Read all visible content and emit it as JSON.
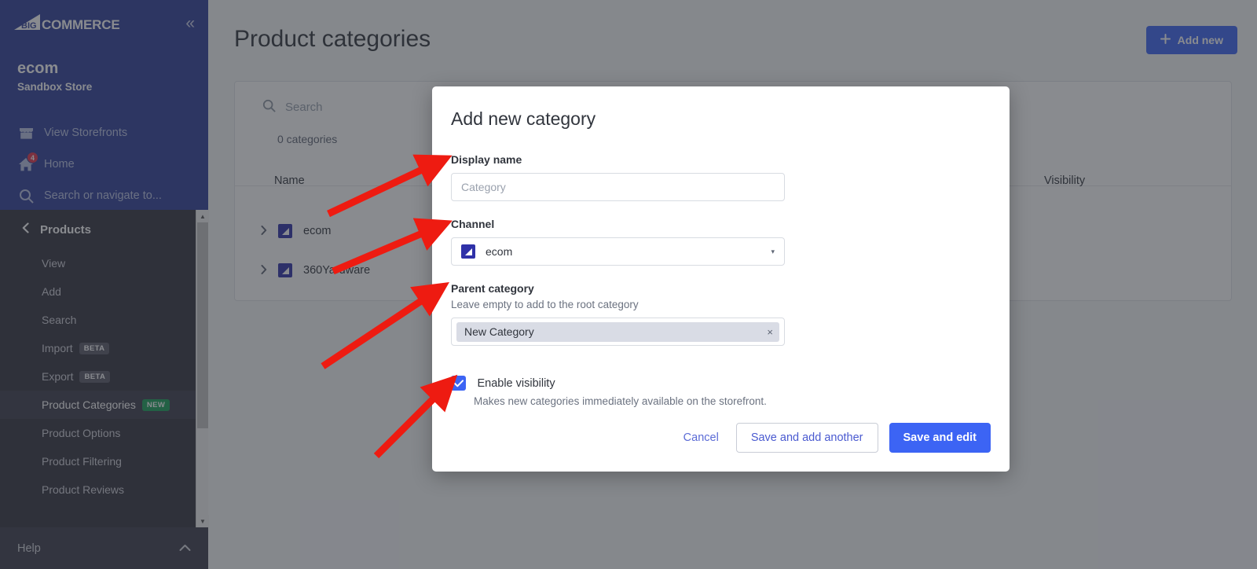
{
  "sidebar": {
    "logo_text": "COMMERCE",
    "logo_mark": "big-triangle-logo",
    "collapse_icon": "«",
    "store_name": "ecom",
    "store_subtitle": "Sandbox Store",
    "links": [
      {
        "label": "View Storefronts",
        "icon": "storefront-icon",
        "badge": null
      },
      {
        "label": "Home",
        "icon": "home-icon",
        "badge": "4"
      },
      {
        "label": "Search or navigate to...",
        "icon": "search-icon",
        "badge": null
      }
    ],
    "nav": {
      "back_label": "Products",
      "back_icon": "chevron-left-icon",
      "items": [
        {
          "label": "View",
          "pill": null,
          "active": false
        },
        {
          "label": "Add",
          "pill": null,
          "active": false
        },
        {
          "label": "Search",
          "pill": null,
          "active": false
        },
        {
          "label": "Import",
          "pill": "BETA",
          "active": false
        },
        {
          "label": "Export",
          "pill": "BETA",
          "active": false
        },
        {
          "label": "Product Categories",
          "pill": "NEW",
          "active": true
        },
        {
          "label": "Product Options",
          "pill": null,
          "active": false
        },
        {
          "label": "Product Filtering",
          "pill": null,
          "active": false
        },
        {
          "label": "Product Reviews",
          "pill": null,
          "active": false
        }
      ]
    },
    "help_label": "Help",
    "help_icon": "chevron-up-icon"
  },
  "page": {
    "title": "Product categories",
    "add_new_label": "Add new",
    "add_new_icon": "plus-icon",
    "search_placeholder": "Search",
    "search_icon": "search-icon",
    "count_label": "0 categories",
    "columns": {
      "name": "Name",
      "visibility": "Visibility"
    },
    "rows": [
      {
        "name": "ecom",
        "icon": "channel-icon",
        "expand_icon": "chevron-right-icon"
      },
      {
        "name": "360Yardware",
        "icon": "channel-icon",
        "expand_icon": "chevron-right-icon"
      }
    ]
  },
  "modal": {
    "title": "Add new category",
    "display_name": {
      "label": "Display name",
      "value": "",
      "placeholder": "Category"
    },
    "channel": {
      "label": "Channel",
      "value": "ecom",
      "icon": "channel-icon",
      "caret": "▾"
    },
    "parent_category": {
      "label": "Parent category",
      "hint": "Leave empty to add to the root category",
      "token": "New Category",
      "remove_icon": "×"
    },
    "visibility": {
      "label": "Enable visibility",
      "checked": true,
      "help": "Makes new categories immediately available on the storefront."
    },
    "buttons": {
      "cancel": "Cancel",
      "save_add_another": "Save and add another",
      "save_edit": "Save and edit"
    }
  },
  "annotations": {
    "arrow_color": "#ee1b11",
    "arrows": [
      {
        "name": "arrow-to-display-name"
      },
      {
        "name": "arrow-to-channel"
      },
      {
        "name": "arrow-to-parent-category"
      },
      {
        "name": "arrow-to-enable-visibility"
      }
    ]
  },
  "colors": {
    "sidebar_top": "#2e3f99",
    "sidebar_dark": "#33323f",
    "primary": "#3c64f4",
    "new_badge": "#18a058",
    "notification": "#e2344d"
  }
}
